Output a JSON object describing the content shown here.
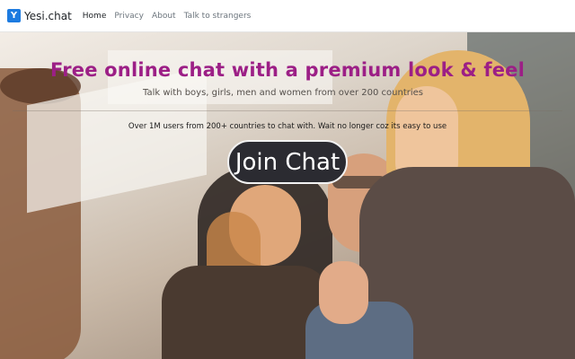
{
  "brand": {
    "name": "Yesi.chat",
    "logo_letter": "Y"
  },
  "nav": {
    "items": [
      {
        "label": "Home",
        "active": true
      },
      {
        "label": "Privacy",
        "active": false
      },
      {
        "label": "About",
        "active": false
      },
      {
        "label": "Talk to strangers",
        "active": false
      }
    ]
  },
  "hero": {
    "headline": "Free online chat with a premium look & feel",
    "subheadline": "Talk with boys, girls, men and women from over 200 countries",
    "tagline": "Over 1M users from 200+ countries to chat with. Wait no longer coz its easy to use",
    "cta_label": "Join Chat"
  },
  "colors": {
    "headline": "#9c1f86",
    "cta_background": "#2b2b31",
    "brand_logo": "#1d7be0"
  }
}
